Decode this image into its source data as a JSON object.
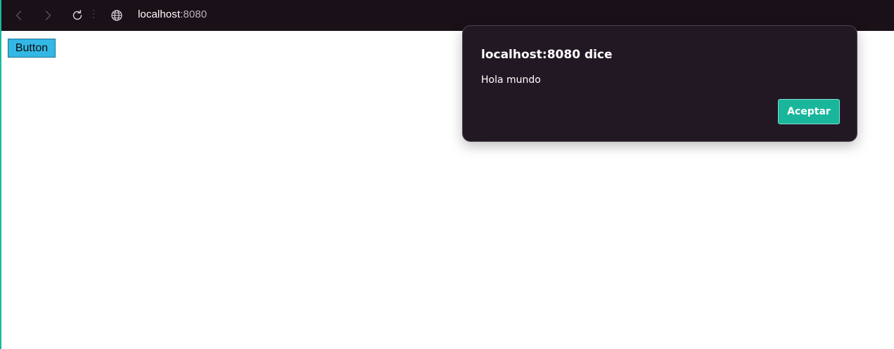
{
  "browser": {
    "address": {
      "host": "localhost",
      "port": ":8080"
    },
    "icons": {
      "back": "chevron-left-icon",
      "forward": "chevron-right-icon",
      "reload": "reload-icon",
      "site_info": "globe-icon"
    }
  },
  "page": {
    "button_label": "Button",
    "button_color": "#33b8e6"
  },
  "alert": {
    "title": "localhost:8080 dice",
    "message": "Hola mundo",
    "ok_label": "Aceptar",
    "ok_color": "#1ab69c",
    "background_color": "#221823"
  },
  "colors": {
    "toolbar": "#1a1018",
    "accent": "#19b89e"
  }
}
